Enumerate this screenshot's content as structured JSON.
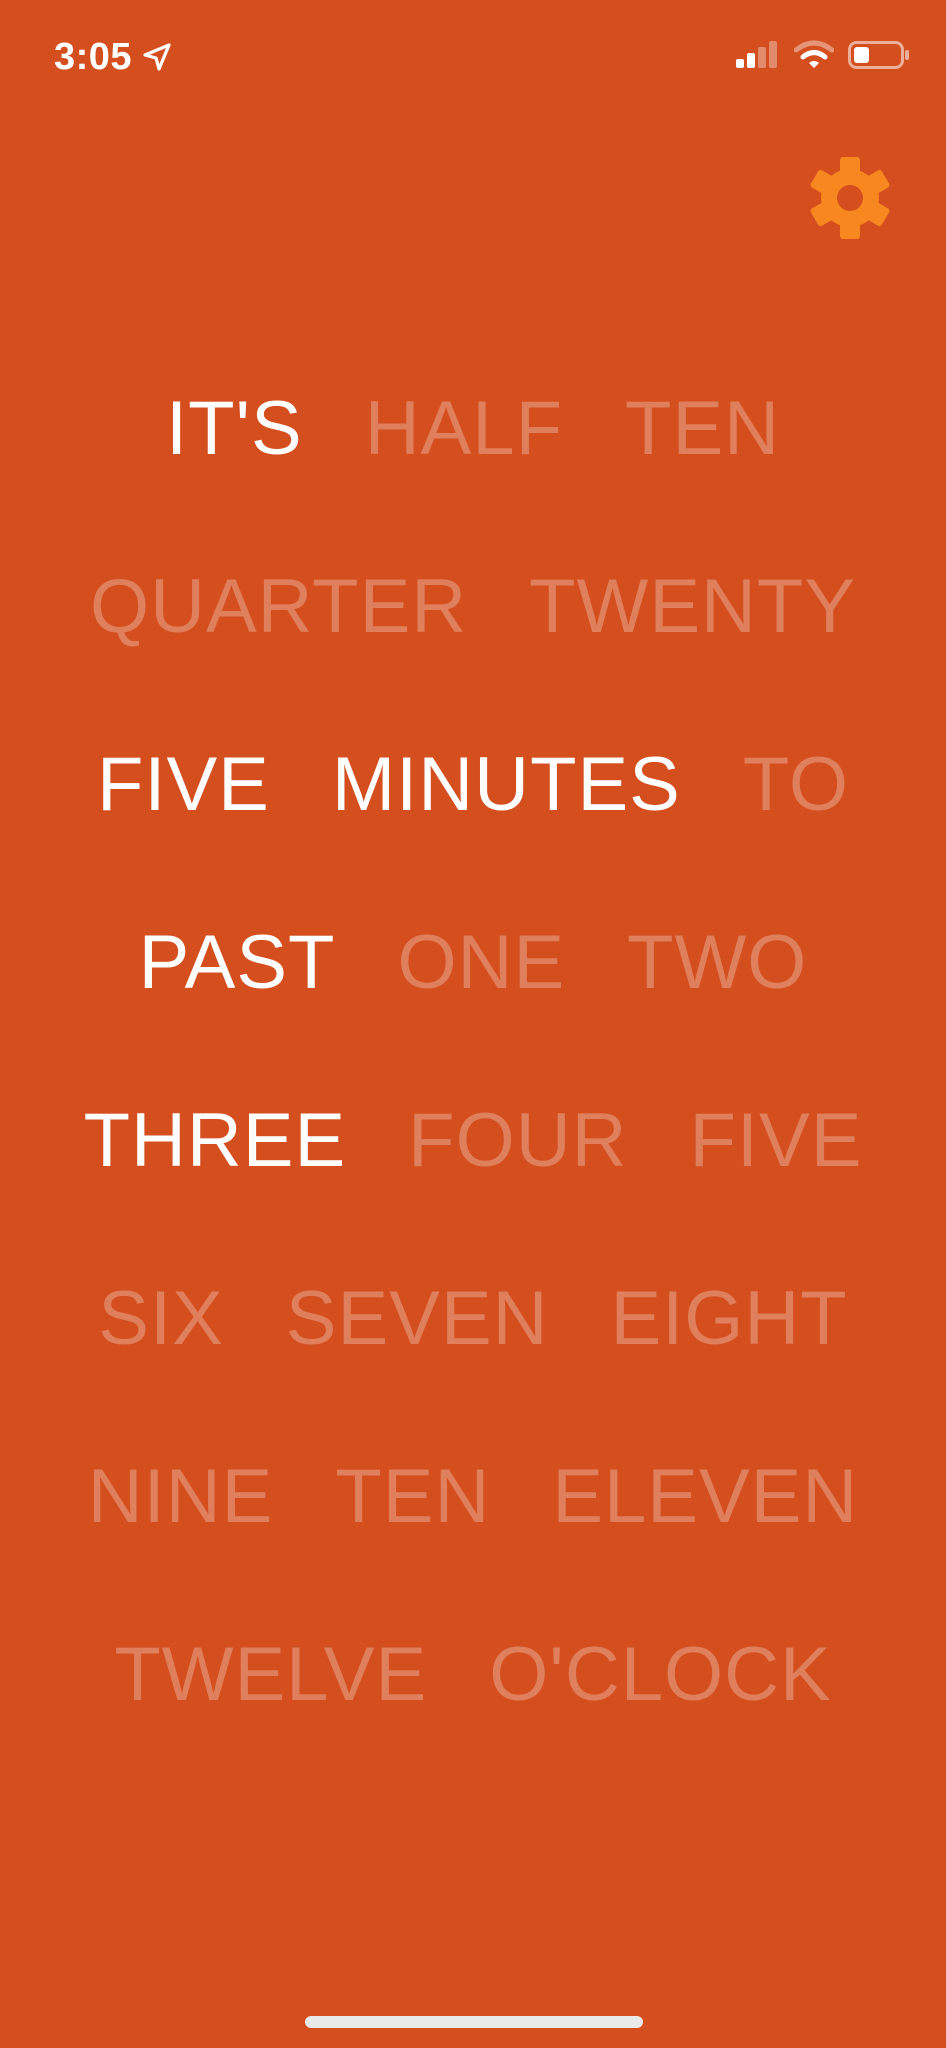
{
  "status_bar": {
    "time": "3:05",
    "location_icon": "location-arrow-icon",
    "signal_icon": "cellular-signal-icon",
    "wifi_icon": "wifi-icon",
    "battery_icon": "battery-icon",
    "signal_bars_active": 2,
    "signal_bars_total": 4,
    "battery_level": 0.3
  },
  "settings": {
    "icon": "gear-icon",
    "color": "#F7871E"
  },
  "colors": {
    "background": "#D54E1E",
    "word_on": "#FFFFFF",
    "word_off": "rgba(255,255,255,0.28)"
  },
  "word_clock": {
    "rows": [
      [
        {
          "text": "IT'S",
          "on": true
        },
        {
          "text": "HALF",
          "on": false
        },
        {
          "text": "TEN",
          "on": false
        }
      ],
      [
        {
          "text": "QUARTER",
          "on": false
        },
        {
          "text": "TWENTY",
          "on": false
        }
      ],
      [
        {
          "text": "FIVE",
          "on": true
        },
        {
          "text": "MINUTES",
          "on": true
        },
        {
          "text": "TO",
          "on": false
        }
      ],
      [
        {
          "text": "PAST",
          "on": true
        },
        {
          "text": "ONE",
          "on": false
        },
        {
          "text": "TWO",
          "on": false
        }
      ],
      [
        {
          "text": "THREE",
          "on": true
        },
        {
          "text": "FOUR",
          "on": false
        },
        {
          "text": "FIVE",
          "on": false
        }
      ],
      [
        {
          "text": "SIX",
          "on": false
        },
        {
          "text": "SEVEN",
          "on": false
        },
        {
          "text": "EIGHT",
          "on": false
        }
      ],
      [
        {
          "text": "NINE",
          "on": false
        },
        {
          "text": "TEN",
          "on": false
        },
        {
          "text": "ELEVEN",
          "on": false
        }
      ],
      [
        {
          "text": "TWELVE",
          "on": false
        },
        {
          "text": "O'CLOCK",
          "on": false
        }
      ]
    ]
  }
}
